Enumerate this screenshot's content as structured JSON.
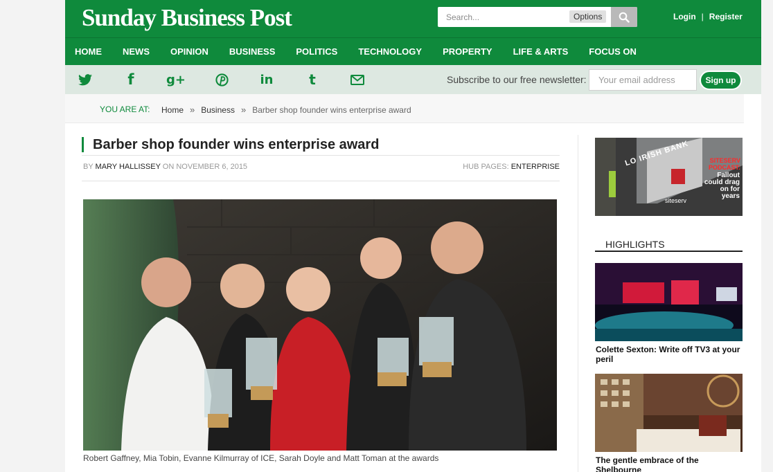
{
  "colors": {
    "brand_green": "#0f8a3c",
    "social_bar": "#dde8e1"
  },
  "header": {
    "logo": "Sunday Business Post",
    "search": {
      "placeholder": "Search...",
      "options_label": "Options",
      "button_icon": "search-icon"
    },
    "auth": {
      "login": "Login",
      "separator": "|",
      "register": "Register"
    }
  },
  "nav": {
    "items": [
      "HOME",
      "NEWS",
      "OPINION",
      "BUSINESS",
      "POLITICS",
      "TECHNOLOGY",
      "PROPERTY",
      "LIFE & ARTS",
      "FOCUS ON"
    ]
  },
  "social": {
    "icons": [
      "twitter-icon",
      "facebook-icon",
      "google-plus-icon",
      "pinterest-icon",
      "linkedin-icon",
      "tumblr-icon",
      "email-icon"
    ],
    "newsletter_label": "Subscribe to our free newsletter:",
    "email_placeholder": "Your email address",
    "signup_label": "Sign up"
  },
  "breadcrumb": {
    "label": "YOU ARE AT:",
    "items": [
      "Home",
      "Business"
    ],
    "separator": "»",
    "current": "Barber shop founder wins enterprise award"
  },
  "article": {
    "title": "Barber shop founder wins enterprise award",
    "by_prefix": "BY",
    "author": "MARY HALLISSEY",
    "date": "ON NOVEMBER 6, 2015",
    "hub_label": "HUB PAGES:",
    "hub_link": "ENTERPRISE",
    "caption": "Robert Gaffney, Mia Tobin, Evanne Kilmurray of ICE, Sarah Doyle and Matt Toman at the awards"
  },
  "sidebar": {
    "ad": {
      "bank_sign": "LO IRISH BANK",
      "headline": "SITESERV PODCAST:",
      "text": "Fallout could drag on for years",
      "brand": "siteserv"
    },
    "highlights_title": "HIGHLIGHTS",
    "highlights": [
      {
        "title": "Colette Sexton: Write off TV3 at your peril"
      },
      {
        "title": "The gentle embrace of the Shelbourne"
      }
    ]
  }
}
